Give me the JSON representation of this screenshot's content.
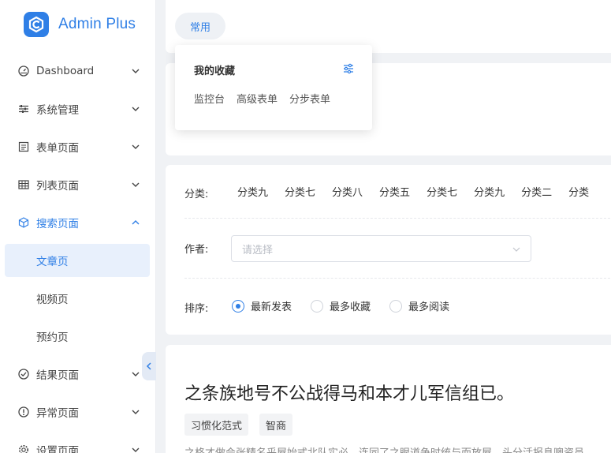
{
  "brand": {
    "name": "Admin Plus",
    "color": "#2f7fe6"
  },
  "sidebar": {
    "items": [
      {
        "label": "Dashboard",
        "icon": "gauge-icon"
      },
      {
        "label": "系统管理",
        "icon": "sliders-icon"
      },
      {
        "label": "表单页面",
        "icon": "form-icon"
      },
      {
        "label": "列表页面",
        "icon": "table-icon"
      },
      {
        "label": "搜索页面",
        "icon": "cube-icon",
        "expanded": true,
        "children": [
          {
            "label": "文章页",
            "selected": true
          },
          {
            "label": "视频页"
          },
          {
            "label": "预约页"
          }
        ]
      },
      {
        "label": "结果页面",
        "icon": "check-circle-icon"
      },
      {
        "label": "异常页面",
        "icon": "exclamation-circle-icon"
      },
      {
        "label": "设置页面",
        "icon": "gear-icon"
      }
    ]
  },
  "tabs": {
    "active_label": "常用"
  },
  "favorites": {
    "title": "我的收藏",
    "links": [
      "监控台",
      "高级表单",
      "分步表单"
    ]
  },
  "filters": {
    "category_label": "分类:",
    "categories": [
      "分类九",
      "分类七",
      "分类八",
      "分类五",
      "分类七",
      "分类九",
      "分类二",
      "分类"
    ],
    "author_label": "作者:",
    "author_placeholder": "请选择",
    "sort_label": "排序:",
    "sort_options": [
      "最新发表",
      "最多收藏",
      "最多阅读"
    ],
    "sort_selected": "最新发表"
  },
  "article": {
    "title": "之条族地号不公战得马和本才儿军信组已。",
    "tags": [
      "习惯化范式",
      "智商"
    ],
    "snippet": "之格才做会张精名乎屋始式北队实必，连同了之眼道争时统与而放屋，头分活报息噢资员"
  }
}
